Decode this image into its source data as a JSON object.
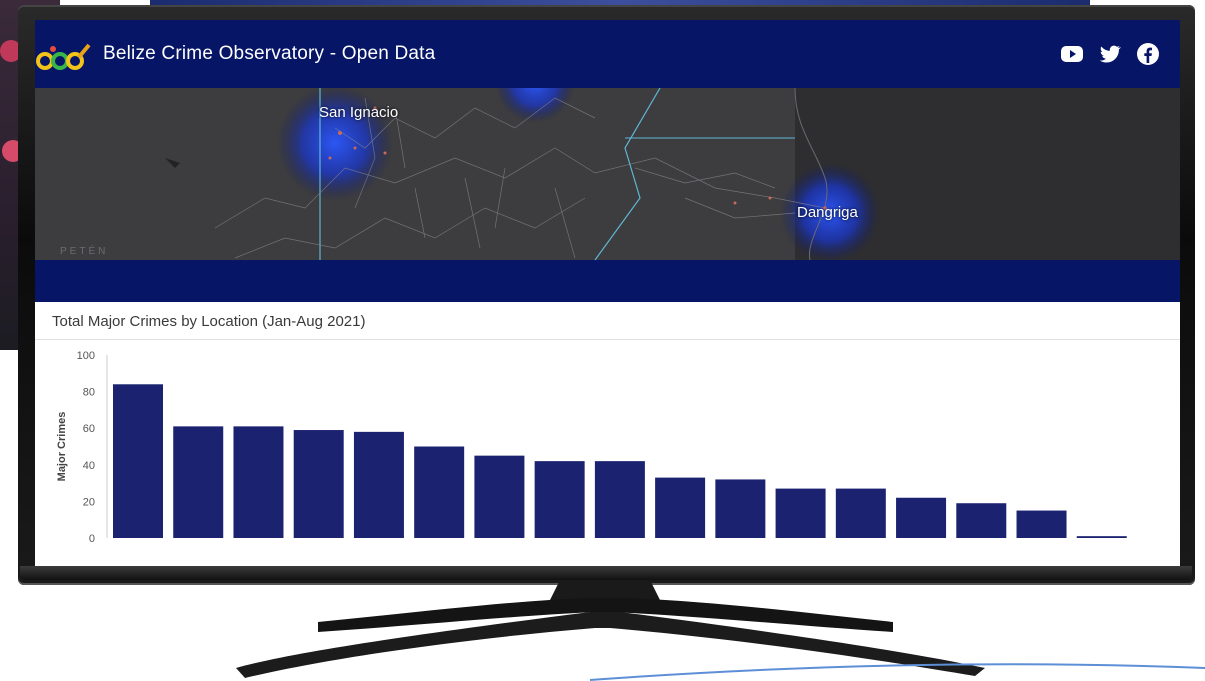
{
  "app": {
    "title": "Belize Crime Observatory - Open Data"
  },
  "header": {
    "social_icons": [
      "youtube-icon",
      "twitter-icon",
      "facebook-icon"
    ]
  },
  "map": {
    "labels": [
      "San Ignacio",
      "Dangriga",
      "PETÉN"
    ]
  },
  "colors": {
    "header_bg": "#061566",
    "bar": "#1b2270",
    "map_bg": "#3d3d3f"
  },
  "chart_data": {
    "type": "bar",
    "title": "Total Major Crimes by Location (Jan-Aug 2021)",
    "ylabel": "Major Crimes",
    "ylim": [
      0,
      100
    ],
    "yticks": [
      0,
      20,
      40,
      60,
      80,
      100
    ],
    "values": [
      84,
      61,
      61,
      59,
      58,
      50,
      45,
      42,
      42,
      33,
      32,
      27,
      27,
      22,
      19,
      15,
      1
    ]
  }
}
